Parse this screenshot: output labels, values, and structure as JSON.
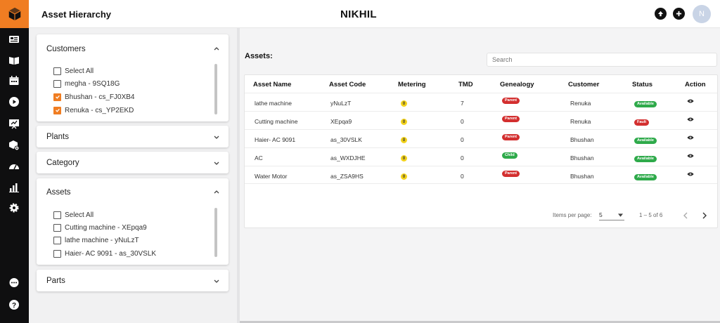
{
  "header": {
    "title": "Asset Hierarchy",
    "user_name": "NIKHIL",
    "avatar_initial": "N"
  },
  "rail": {
    "icons": [
      "dashboard-icon",
      "book-icon",
      "calendar-icon",
      "play-icon",
      "chart-board-icon",
      "cube-gear-icon",
      "gauge-icon",
      "bar-chart-icon",
      "settings-icon"
    ],
    "bottom_icons": [
      "chat-icon",
      "help-icon"
    ]
  },
  "filters": {
    "customers": {
      "title": "Customers",
      "options": [
        {
          "label": "Select All",
          "checked": false
        },
        {
          "label": "megha - 9SQ18G",
          "checked": false
        },
        {
          "label": "Bhushan - cs_FJ0XB4",
          "checked": true
        },
        {
          "label": "Renuka - cs_YP2EKD",
          "checked": true
        }
      ]
    },
    "plants": {
      "title": "Plants"
    },
    "category": {
      "title": "Category"
    },
    "assets": {
      "title": "Assets",
      "options": [
        {
          "label": "Select All",
          "checked": false
        },
        {
          "label": "Cutting machine - XEpqa9",
          "checked": false
        },
        {
          "label": "lathe machine - yNuLzT",
          "checked": false
        },
        {
          "label": "Haier- AC 9091 - as_30VSLK",
          "checked": false
        }
      ]
    },
    "parts": {
      "title": "Parts"
    }
  },
  "main": {
    "heading": "Assets:",
    "search_placeholder": "Search",
    "columns": [
      "Asset Name",
      "Asset Code",
      "Metering",
      "TMD",
      "Genealogy",
      "Customer",
      "Status",
      "Action"
    ],
    "rows": [
      {
        "name": "lathe machine",
        "code": "yNuLzT",
        "metering": "0",
        "tmd": "7",
        "genealogy": "Parent",
        "customer": "Renuka",
        "status": "Available"
      },
      {
        "name": "Cutting machine",
        "code": "XEpqa9",
        "metering": "0",
        "tmd": "0",
        "genealogy": "Parent",
        "customer": "Renuka",
        "status": "Fault"
      },
      {
        "name": "Haier- AC 9091",
        "code": "as_30VSLK",
        "metering": "0",
        "tmd": "0",
        "genealogy": "Parent",
        "customer": "Bhushan",
        "status": "Available"
      },
      {
        "name": "AC",
        "code": "as_WXDJHE",
        "metering": "0",
        "tmd": "0",
        "genealogy": "Child",
        "customer": "Bhushan",
        "status": "Available"
      },
      {
        "name": "Water Motor",
        "code": "as_ZSA9HS",
        "metering": "0",
        "tmd": "0",
        "genealogy": "Parent",
        "customer": "Bhushan",
        "status": "Available"
      }
    ],
    "pagination": {
      "items_per_page_label": "Items per page:",
      "items_per_page": "5",
      "range": "1 – 5 of 6"
    }
  },
  "colors": {
    "accent": "#f07d22",
    "parent": "#d32f2f",
    "child": "#2eaa4a",
    "available": "#2eaa4a",
    "fault": "#d32f2f",
    "meter": "#f2d21b"
  }
}
